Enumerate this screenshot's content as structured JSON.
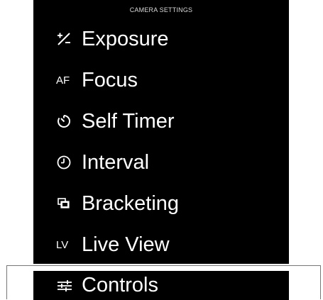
{
  "colors": {
    "background": "#000000",
    "text": "#ffffff",
    "header_text": "#d8d8d8",
    "page": "#ffffff"
  },
  "header": {
    "title": "CAMERA SETTINGS"
  },
  "menu": {
    "items": [
      {
        "label": "Exposure",
        "icon": "exposure-compensation-icon"
      },
      {
        "label": "Focus",
        "icon": "autofocus-icon",
        "icon_text": "AF"
      },
      {
        "label": "Self Timer",
        "icon": "self-timer-icon"
      },
      {
        "label": "Interval",
        "icon": "clock-icon"
      },
      {
        "label": "Bracketing",
        "icon": "bracketing-icon"
      },
      {
        "label": "Live View",
        "icon": "live-view-icon",
        "icon_text": "LV"
      },
      {
        "label": "Controls",
        "icon": "controls-icon"
      }
    ]
  }
}
